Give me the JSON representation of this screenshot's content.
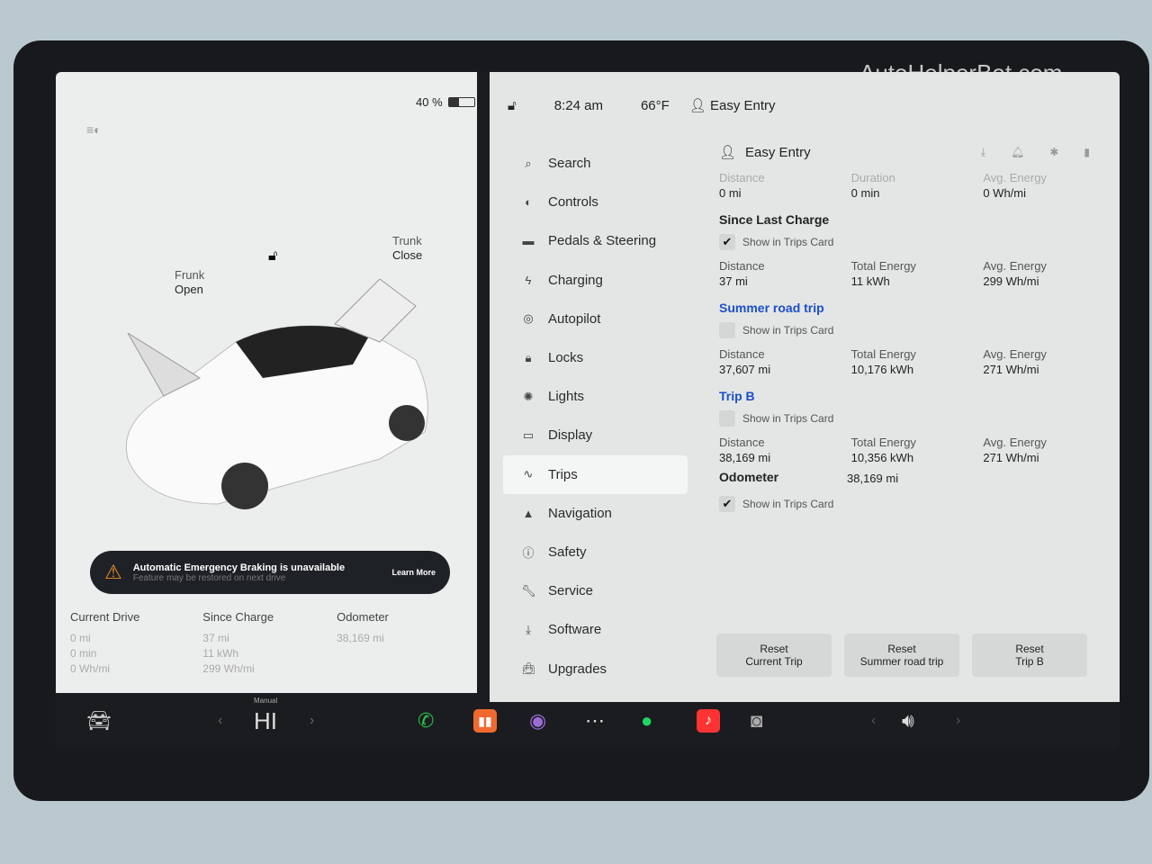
{
  "status": {
    "battery": "40 %",
    "battery_percent": 40,
    "time": "8:24 am",
    "temp": "66°F",
    "profile": "Easy Entry"
  },
  "vehicle": {
    "frunk_label": "Frunk",
    "frunk_state": "Open",
    "trunk_label": "Trunk",
    "trunk_state": "Close"
  },
  "alert": {
    "title": "Automatic Emergency Braking is unavailable",
    "subtitle": "Feature may be restored on next drive",
    "action": "Learn More"
  },
  "summary": {
    "current_drive": {
      "title": "Current Drive",
      "lines": [
        "0 mi",
        "0 min",
        "0 Wh/mi"
      ]
    },
    "since_charge": {
      "title": "Since Charge",
      "lines": [
        "37 mi",
        "11 kWh",
        "299 Wh/mi"
      ]
    },
    "odometer": {
      "title": "Odometer",
      "lines": [
        "38,169 mi"
      ]
    }
  },
  "menu": [
    {
      "label": "Search",
      "icon": "search-icon"
    },
    {
      "label": "Controls",
      "icon": "toggle-icon"
    },
    {
      "label": "Pedals & Steering",
      "icon": "car-icon"
    },
    {
      "label": "Charging",
      "icon": "bolt-icon"
    },
    {
      "label": "Autopilot",
      "icon": "steering-wheel-icon"
    },
    {
      "label": "Locks",
      "icon": "lock-icon"
    },
    {
      "label": "Lights",
      "icon": "light-icon"
    },
    {
      "label": "Display",
      "icon": "display-icon"
    },
    {
      "label": "Trips",
      "icon": "trips-icon",
      "active": true
    },
    {
      "label": "Navigation",
      "icon": "navigation-icon"
    },
    {
      "label": "Safety",
      "icon": "safety-icon"
    },
    {
      "label": "Service",
      "icon": "wrench-icon"
    },
    {
      "label": "Software",
      "icon": "download-icon"
    },
    {
      "label": "Upgrades",
      "icon": "bag-icon"
    }
  ],
  "trips": {
    "profile": "Easy Entry",
    "current": {
      "distance_label": "Distance",
      "distance": "0 mi",
      "duration_label": "Duration",
      "duration": "0 min",
      "energy_label": "Avg. Energy",
      "energy": "0 Wh/mi"
    },
    "sections": [
      {
        "title": "Since Last Charge",
        "checked": true,
        "show": "Show in Trips Card",
        "distance": "37 mi",
        "total": "11 kWh",
        "avg": "299 Wh/mi"
      },
      {
        "title": "Summer road trip",
        "checked": false,
        "show": "Show in Trips Card",
        "distance": "37,607 mi",
        "total": "10,176 kWh",
        "avg": "271 Wh/mi"
      },
      {
        "title": "Trip B",
        "checked": false,
        "show": "Show in Trips Card",
        "distance": "38,169 mi",
        "total": "10,356 kWh",
        "avg": "271 Wh/mi"
      }
    ],
    "labels": {
      "distance": "Distance",
      "total": "Total Energy",
      "avg": "Avg. Energy"
    },
    "odometer_label": "Odometer",
    "odometer": "38,169 mi",
    "odometer_show": "Show in Trips Card",
    "buttons": [
      "Reset\nCurrent Trip",
      "Reset\nSummer road trip",
      "Reset\nTrip B"
    ]
  },
  "dock": {
    "climate_mode": "Manual",
    "climate_value": "HI"
  },
  "watermark": "AutoHelperBot.com",
  "colors": {
    "accent": "#1c4fc9",
    "warning": "#f08a24"
  }
}
